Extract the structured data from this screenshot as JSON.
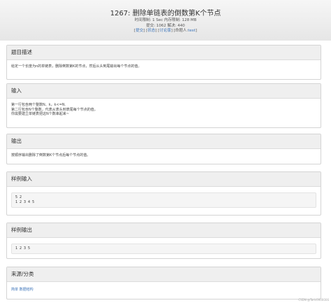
{
  "header": {
    "title": "1267: 删除单链表的倒数第K个节点",
    "limits": "时间限制: 1 Sec  内存限制: 128 MB",
    "stats": "提交: 1062  解决: 440",
    "links": [
      "提交",
      "状态",
      "讨论版"
    ],
    "setter_label": "命题人:",
    "setter_name": "test"
  },
  "sections": {
    "description": {
      "title": "题目描述",
      "body": "给定一个长度为n的单链表，删除倒数第K的节点，然后从头到尾输出每个节点的值。"
    },
    "input": {
      "title": "输入",
      "lines": [
        "第一行包含两个整数N、k，k<=N.",
        "第二行包含N个整数，代表从表头到表尾每个节点的值。",
        "你需要建立单链表把这N个数串起来~"
      ]
    },
    "output": {
      "title": "输出",
      "body": "按顺序输出删除了倒数第K个节点后每个节点的值。"
    },
    "sample_input": {
      "title": "样例输入",
      "lines": [
        "5 2",
        "1 2 3 4 5"
      ]
    },
    "sample_output": {
      "title": "样例输出",
      "lines": [
        "1 2 3 5"
      ]
    },
    "source": {
      "title": "来源/分类",
      "tags": "简单 数据结构"
    }
  },
  "watermark": "CSDN @Taric0000006"
}
